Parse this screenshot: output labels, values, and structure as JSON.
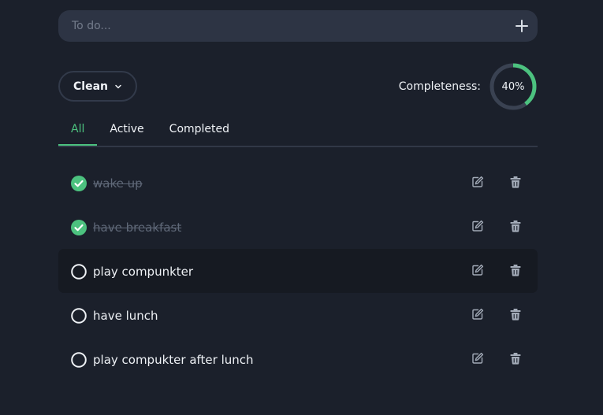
{
  "input": {
    "placeholder": "To do...",
    "add_icon": "plus-icon"
  },
  "filter": {
    "label": "Clean",
    "icon": "chevron-down-icon"
  },
  "completeness": {
    "label": "Completeness:",
    "value_text": "40%",
    "fraction": 0.4
  },
  "tabs": [
    {
      "label": "All",
      "active": true
    },
    {
      "label": "Active",
      "active": false
    },
    {
      "label": "Completed",
      "active": false
    }
  ],
  "todos": [
    {
      "text": "wake up",
      "completed": true
    },
    {
      "text": "have breakfast",
      "completed": true
    },
    {
      "text": "play compunkter",
      "completed": false
    },
    {
      "text": "have lunch",
      "completed": false
    },
    {
      "text": "play compukter after lunch",
      "completed": false
    }
  ],
  "colors": {
    "background": "#1b202b",
    "accent": "#4cc27f",
    "input_bg": "#2d3444",
    "ring_track": "#3a4252",
    "muted_text": "#5f6878",
    "icon": "#a3abb8"
  }
}
